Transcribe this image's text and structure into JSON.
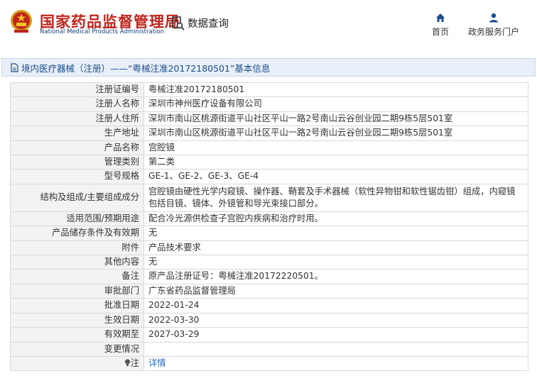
{
  "header": {
    "site_name_cn": "国家药品监督管理局",
    "site_name_en": "National Medical Products Administration",
    "data_query": "数据查询",
    "nav_home": "首页",
    "nav_portal": "政务服务门户"
  },
  "title": "境内医疗器械（注册）——“粤械注准20172180501”基本信息",
  "rows": [
    {
      "label": "注册证编号",
      "value": "粤械注准20172180501"
    },
    {
      "label": "注册人名称",
      "value": "深圳市神州医疗设备有限公司"
    },
    {
      "label": "注册人住所",
      "value": "深圳市南山区桃源街道平山社区平山一路2号南山云谷创业园二期9栋5层501室"
    },
    {
      "label": "生产地址",
      "value": "深圳市南山区桃源街道平山社区平山一路2号南山云谷创业园二期9栋5层501室"
    },
    {
      "label": "产品名称",
      "value": "宫腔镜"
    },
    {
      "label": "管理类别",
      "value": "第二类"
    },
    {
      "label": "型号规格",
      "value": "GE-1、GE-2、GE-3、GE-4"
    },
    {
      "label": "结构及组成/主要组成成分",
      "value": "宫腔镜由硬性光学内窥镜、操作器、鞘套及手术器械（软性异物钳和软性锯齿钳）组成，内窥镜包括目镜、镜体、外镜管和导光束接口部分。"
    },
    {
      "label": "适用范围/预期用途",
      "value": "配合冷光源供检查子宫腔内疾病和治疗时用。"
    },
    {
      "label": "产品储存条件及有效期",
      "value": "无"
    },
    {
      "label": "附件",
      "value": "产品技术要求"
    },
    {
      "label": "其他内容",
      "value": "无"
    },
    {
      "label": "备注",
      "value": "原产品注册证号：粤械注准20172220501。"
    },
    {
      "label": "审批部门",
      "value": "广东省药品监督管理局"
    },
    {
      "label": "批准日期",
      "value": "2022-01-24"
    },
    {
      "label": "生效日期",
      "value": "2022-03-30"
    },
    {
      "label": "有效期至",
      "value": "2027-03-29"
    },
    {
      "label": "变更情况",
      "value": ""
    },
    {
      "label": "注",
      "value": "详情"
    }
  ]
}
